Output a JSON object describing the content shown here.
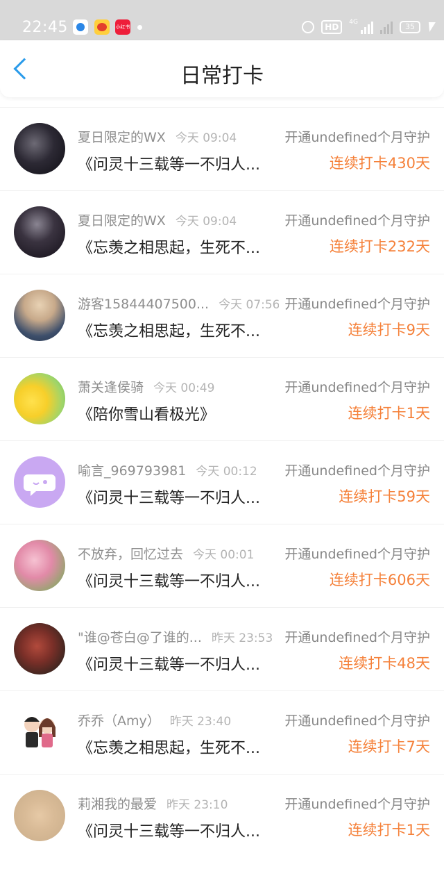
{
  "status_bar": {
    "time": "22:45",
    "apps": [
      "browser-app-icon",
      "weibo-app-icon",
      "xiaohongshu-app-icon"
    ],
    "app3_label": "小红书",
    "network_label": "4G",
    "hd_label": "HD",
    "battery": "35"
  },
  "header": {
    "title": "日常打卡",
    "accent_color": "#2a9bea"
  },
  "items": [
    {
      "name": "夏日限定的WX",
      "time": "今天 09:04",
      "guard": "开通undefined个月守护",
      "message": "《问灵十三载等一不归人...",
      "streak": "连续打卡430天"
    },
    {
      "name": "夏日限定的WX",
      "time": "今天 09:04",
      "guard": "开通undefined个月守护",
      "message": "《忘羡之相思起，生死不...",
      "streak": "连续打卡232天"
    },
    {
      "name": "游客15844407500...",
      "time": "今天 07:56",
      "guard": "开通undefined个月守护",
      "message": "《忘羡之相思起，生死不...",
      "streak": "连续打卡9天"
    },
    {
      "name": "萧关逢侯骑",
      "time": "今天 00:49",
      "guard": "开通undefined个月守护",
      "message": "《陪你雪山看极光》",
      "streak": "连续打卡1天"
    },
    {
      "name": "喻言_969793981",
      "time": "今天 00:12",
      "guard": "开通undefined个月守护",
      "message": "《问灵十三载等一不归人...",
      "streak": "连续打卡59天"
    },
    {
      "name": "不放弃，回忆过去",
      "time": "今天 00:01",
      "guard": "开通undefined个月守护",
      "message": "《问灵十三载等一不归人...",
      "streak": "连续打卡606天"
    },
    {
      "name": "\"谁@苍白@了谁的...",
      "time": "昨天 23:53",
      "guard": "开通undefined个月守护",
      "message": "《问灵十三载等一不归人...",
      "streak": "连续打卡48天"
    },
    {
      "name": "乔乔（Amy）",
      "time": "昨天 23:40",
      "guard": "开通undefined个月守护",
      "message": "《忘羡之相思起，生死不...",
      "streak": "连续打卡7天"
    },
    {
      "name": "莉湘我的最爱",
      "time": "昨天 23:10",
      "guard": "开通undefined个月守护",
      "message": "《问灵十三载等一不归人...",
      "streak": "连续打卡1天"
    }
  ],
  "colors": {
    "streak": "#f5813a",
    "status_bar_bg": "#d9d9d9"
  }
}
